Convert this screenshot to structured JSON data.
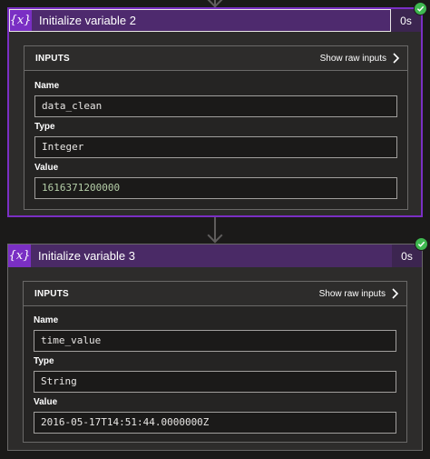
{
  "colors": {
    "accent": "#7a2fc4",
    "success": "#3fb950",
    "number_value": "#b5cea8"
  },
  "actions": [
    {
      "icon": "curly-braces-x-icon",
      "icon_text": "{x}",
      "title": "Initialize variable 2",
      "duration": "0s",
      "status": "succeeded",
      "section_title": "INPUTS",
      "raw_link": "Show raw inputs",
      "fields": [
        {
          "label": "Name",
          "value": "data_clean"
        },
        {
          "label": "Type",
          "value": "Integer"
        },
        {
          "label": "Value",
          "value": "1616371200000"
        }
      ]
    },
    {
      "icon": "curly-braces-x-icon",
      "icon_text": "{x}",
      "title": "Initialize variable 3",
      "duration": "0s",
      "status": "succeeded",
      "section_title": "INPUTS",
      "raw_link": "Show raw inputs",
      "fields": [
        {
          "label": "Name",
          "value": "time_value"
        },
        {
          "label": "Type",
          "value": "String"
        },
        {
          "label": "Value",
          "value": "2016-05-17T14:51:44.0000000Z"
        }
      ]
    }
  ]
}
